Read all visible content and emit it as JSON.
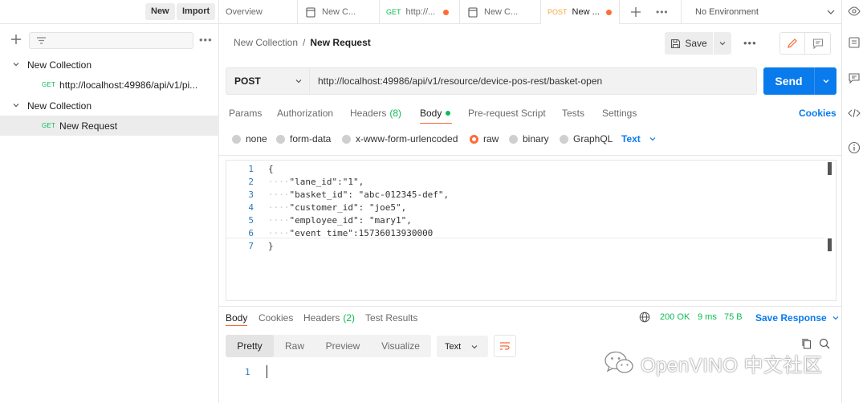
{
  "sidebar": {
    "new_label": "New",
    "import_label": "Import",
    "tree": [
      {
        "label": "New Collection"
      },
      {
        "method": "GET",
        "label": "http://localhost:49986/api/v1/pi..."
      },
      {
        "label": "New Collection"
      },
      {
        "method": "GET",
        "label": "New Request"
      }
    ]
  },
  "tabs": [
    {
      "label": "Overview"
    },
    {
      "label": "New C..."
    },
    {
      "method": "GET",
      "label": "http://..."
    },
    {
      "label": "New C..."
    },
    {
      "method": "POST",
      "label": "New ..."
    }
  ],
  "environment": "No Environment",
  "header": {
    "breadcrumb_parent": "New Collection",
    "breadcrumb_sep": "/",
    "breadcrumb_current": "New Request",
    "save_label": "Save"
  },
  "request": {
    "method": "POST",
    "url": "http://localhost:49986/api/v1/resource/device-pos-rest/basket-open",
    "send_label": "Send",
    "tabs": {
      "params": "Params",
      "authorization": "Authorization",
      "headers": "Headers",
      "headers_count": "(8)",
      "body": "Body",
      "prerequest": "Pre-request Script",
      "tests": "Tests",
      "settings": "Settings"
    },
    "cookies_label": "Cookies",
    "body_types": {
      "none": "none",
      "form_data": "form-data",
      "urlencoded": "x-www-form-urlencoded",
      "raw": "raw",
      "binary": "binary",
      "graphql": "GraphQL"
    },
    "body_format": "Text",
    "body_lines": [
      {
        "n": "1",
        "indent": "",
        "text": "{"
      },
      {
        "n": "2",
        "indent": "····",
        "text": "\"lane_id\":\"1\","
      },
      {
        "n": "3",
        "indent": "····",
        "text": "\"basket_id\": \"abc-012345-def\","
      },
      {
        "n": "4",
        "indent": "····",
        "text": "\"customer_id\": \"joe5\","
      },
      {
        "n": "5",
        "indent": "····",
        "text": "\"employee_id\": \"mary1\","
      },
      {
        "n": "6",
        "indent": "····",
        "text": "\"event_time\":15736013930000"
      },
      {
        "n": "7",
        "indent": "",
        "text": "}"
      }
    ]
  },
  "response": {
    "tabs": {
      "body": "Body",
      "cookies": "Cookies",
      "headers": "Headers",
      "headers_count": "(2)",
      "test_results": "Test Results"
    },
    "status": "200 OK",
    "time": "9 ms",
    "size": "75 B",
    "save_label": "Save Response",
    "views": {
      "pretty": "Pretty",
      "raw": "Raw",
      "preview": "Preview",
      "visualize": "Visualize"
    },
    "format": "Text",
    "line_number": "1"
  },
  "watermark": "OpenVINO 中文社区",
  "colors": {
    "accent": "#ff6c37",
    "primary": "#097bed",
    "success": "#0cbb52",
    "post": "#f4a742"
  }
}
